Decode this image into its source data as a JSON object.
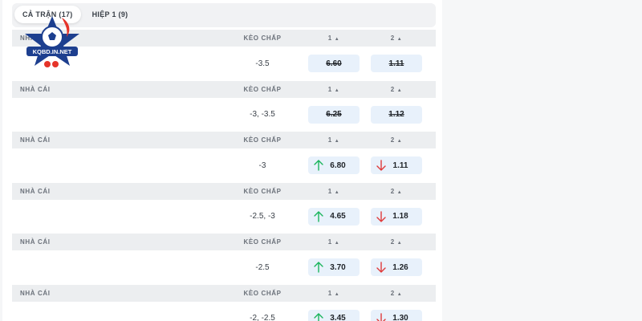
{
  "tabs": [
    {
      "label": "CẢ TRẬN (17)",
      "active": true
    },
    {
      "label": "HIỆP 1 (9)",
      "active": false
    }
  ],
  "columns": {
    "bookmaker": "NHÀ CÁI",
    "handicap": "KÈO CHẤP",
    "home": "1",
    "away": "2"
  },
  "logo_text": "KQBD.IN.NET",
  "rows": [
    {
      "handicap": "-3.5",
      "home": {
        "value": "6.60",
        "trend": "none",
        "closed": true
      },
      "away": {
        "value": "1.11",
        "trend": "none",
        "closed": true
      }
    },
    {
      "handicap": "-3, -3.5",
      "home": {
        "value": "6.25",
        "trend": "none",
        "closed": true
      },
      "away": {
        "value": "1.12",
        "trend": "none",
        "closed": true
      }
    },
    {
      "handicap": "-3",
      "home": {
        "value": "6.80",
        "trend": "up",
        "closed": false
      },
      "away": {
        "value": "1.11",
        "trend": "down",
        "closed": false
      }
    },
    {
      "handicap": "-2.5, -3",
      "home": {
        "value": "4.65",
        "trend": "up",
        "closed": false
      },
      "away": {
        "value": "1.18",
        "trend": "down",
        "closed": false
      }
    },
    {
      "handicap": "-2.5",
      "home": {
        "value": "3.70",
        "trend": "up",
        "closed": false
      },
      "away": {
        "value": "1.26",
        "trend": "down",
        "closed": false
      }
    },
    {
      "handicap": "-2, -2.5",
      "home": {
        "value": "3.45",
        "trend": "up",
        "closed": false
      },
      "away": {
        "value": "1.30",
        "trend": "down",
        "closed": false
      }
    }
  ],
  "colors": {
    "up": "#1bb55c",
    "down": "#e03a3a",
    "odd_bg": "#e8f1fb",
    "logo_blue": "#1d3f8f",
    "logo_red": "#e5342a"
  }
}
